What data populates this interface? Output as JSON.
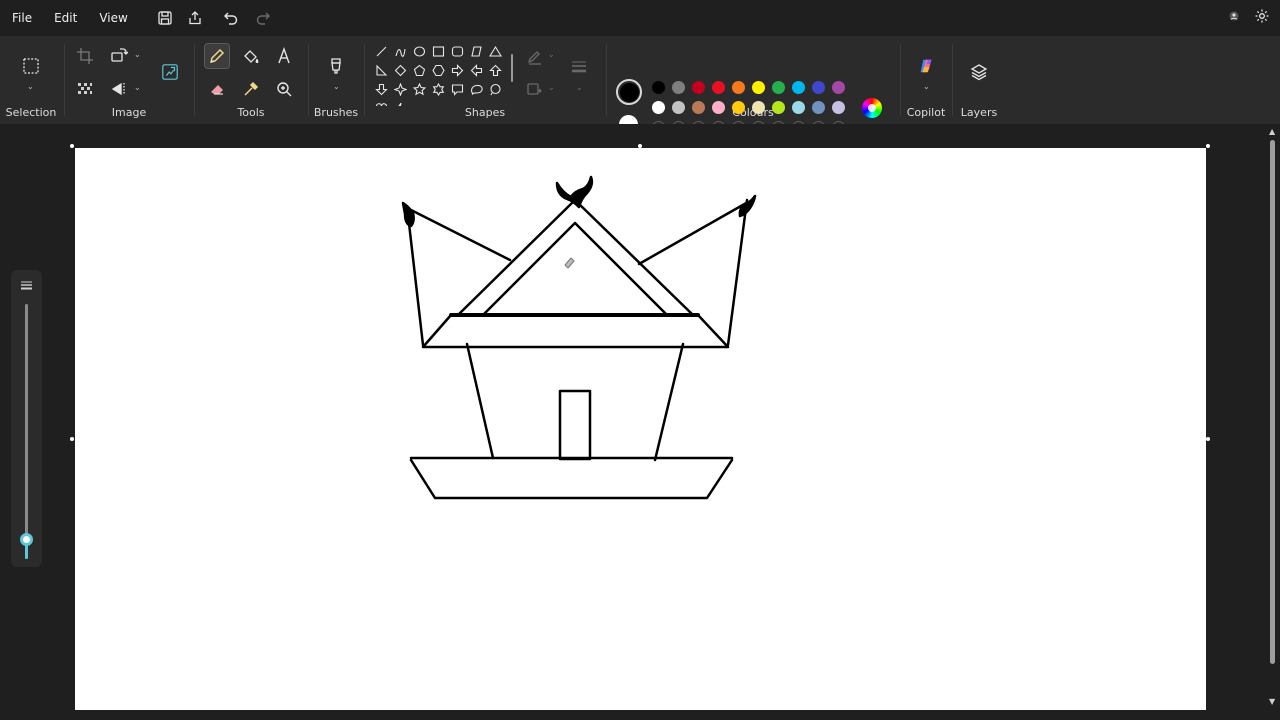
{
  "menu": {
    "file": "File",
    "edit": "Edit",
    "view": "View"
  },
  "ribbon": {
    "groups": {
      "selection": "Selection",
      "image": "Image",
      "tools": "Tools",
      "brushes": "Brushes",
      "shapes": "Shapes",
      "colours": "Colours",
      "copilot": "Copilot",
      "layers": "Layers"
    },
    "colours": {
      "primary": "#000000",
      "secondary": "#ffffff",
      "row1": [
        "#000000",
        "#7f7f7f",
        "#c4001c",
        "#e81123",
        "#f7781d",
        "#fff000",
        "#22b14c",
        "#00b7eb",
        "#3f48cc",
        "#a349a4"
      ],
      "row2": [
        "#ffffff",
        "#c3c3c3",
        "#b97a57",
        "#ffaec9",
        "#ffc90e",
        "#efe4b0",
        "#b5e61d",
        "#99d9ea",
        "#7092be",
        "#c8bfe7"
      ]
    }
  },
  "zoom": {
    "level_fraction": 0.08
  }
}
